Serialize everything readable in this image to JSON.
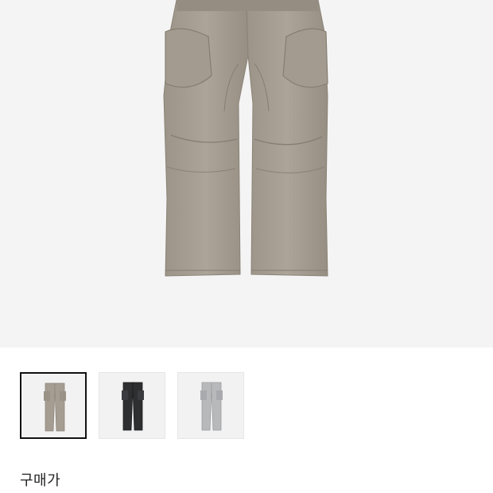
{
  "product": {
    "main_image": {
      "icon": "cargo-pants-photo",
      "color": "#a29a8e"
    },
    "variants": [
      {
        "color_name_icon": "beige-cargo-pants-thumbnail",
        "color": "#a59d92",
        "selected": true
      },
      {
        "color_name_icon": "black-cargo-pants-thumbnail",
        "color": "#2e2f31",
        "selected": false
      },
      {
        "color_name_icon": "gray-cargo-pants-thumbnail",
        "color": "#b8b9bb",
        "selected": false
      }
    ]
  },
  "pricing": {
    "label": "구매가"
  },
  "colors": {
    "hero_bg": "#f4f4f4",
    "thumb_bg": "#f2f2f2",
    "selected_border": "#111111"
  }
}
